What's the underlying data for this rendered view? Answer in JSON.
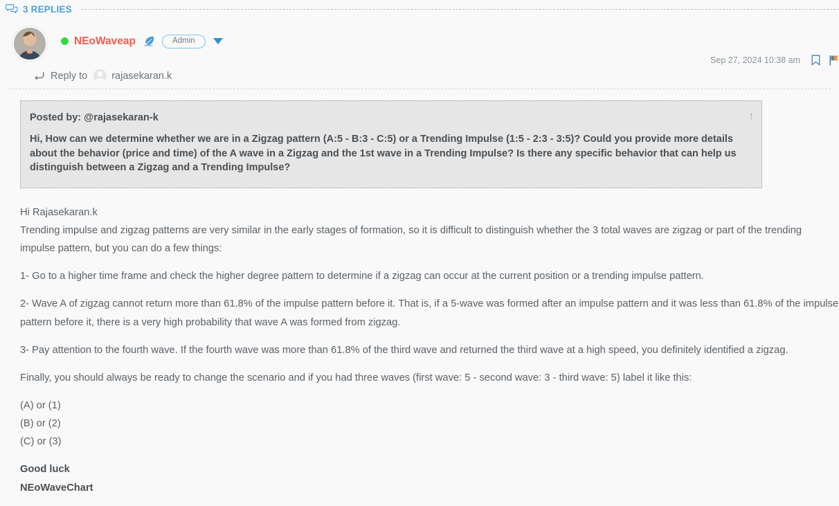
{
  "replies_bar": {
    "icon": "comments-icon",
    "label": "3 REPLIES"
  },
  "post": {
    "author": {
      "name": "NEoWaveap",
      "status": "online",
      "badge": "Admin",
      "feather_icon": "feather-pen-icon",
      "caret_icon": "chevron-down-icon"
    },
    "timestamp": "Sep 27, 2024 10:38 am",
    "actions": {
      "bookmark": "bookmark-icon",
      "report": "flag-icon"
    },
    "reply_to": {
      "prefix": "Reply to",
      "user": "rajasekaran.k",
      "arrow_icon": "reply-arrow-icon"
    },
    "quote": {
      "posted_by": "Posted by: @rajasekaran-k",
      "text": "Hi, How can we determine whether we are in a Zigzag pattern (A:5 - B:3 - C:5) or a Trending Impulse (1:5 - 2:3 - 3:5)? Could you provide more details about the behavior (price and time) of the A wave in a Zigzag and the 1st wave in a Trending Impulse? Is there any specific behavior that can help us distinguish between a Zigzag and a Trending Impulse?",
      "jump_icon": "↑"
    },
    "body": {
      "greeting": "Hi Rajasekaran.k",
      "intro": "Trending impulse and zigzag patterns are very similar in the early stages of formation, so it is difficult to distinguish whether the 3 total waves are zigzag or part of the trending impulse pattern, but you can do a few things:",
      "point_1": "1- Go to a higher time frame and check the higher degree pattern to determine if a zigzag can occur at the current position or a trending impulse pattern.",
      "point_2": "2- Wave A of zigzag cannot return more than 61.8% of the impulse pattern before it. That is, if a 5-wave was formed after an impulse pattern and it was less than 61.8% of the impulse pattern before it, there is a very high probability that wave A was formed from zigzag.",
      "point_3": "3- Pay attention to the fourth wave. If the fourth wave was more than 61.8% of the third wave and returned the third wave at a high speed, you definitely identified a zigzag.",
      "closing": "Finally, you should always be ready to change the scenario and if you had three waves (first wave: 5 - second wave: 3 - third wave: 5) label it like this:",
      "label_a": "(A) or (1)",
      "label_b": "(B) or (2)",
      "label_c": "(C) or (3)",
      "signoff": "Good luck",
      "signature": "NEoWaveChart"
    }
  },
  "colors": {
    "accent_blue": "#49a0d8",
    "username_red": "#f4594f",
    "online_green": "#35d93f",
    "page_bg": "#f9f9fa",
    "quote_bg": "#e6e6e6",
    "text": "#5a6166"
  }
}
